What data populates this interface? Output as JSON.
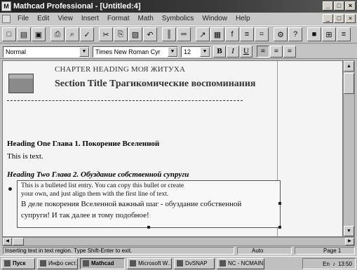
{
  "window": {
    "title": "Mathcad Professional - [Untitled:4]",
    "min_label": "_",
    "max_label": "□",
    "close_label": "×"
  },
  "menu": {
    "items": [
      "File",
      "Edit",
      "View",
      "Insert",
      "Format",
      "Math",
      "Symbolics",
      "Window",
      "Help"
    ]
  },
  "toolbar": {
    "buttons": [
      {
        "name": "new-icon",
        "glyph": "□"
      },
      {
        "name": "open-icon",
        "glyph": "▤"
      },
      {
        "name": "save-icon",
        "glyph": "▣"
      },
      {
        "name": "print-icon",
        "glyph": "⎙"
      },
      {
        "name": "print-preview-icon",
        "glyph": "⌕"
      },
      {
        "name": "spell-check-icon",
        "glyph": "✓"
      },
      {
        "name": "cut-icon",
        "glyph": "✂"
      },
      {
        "name": "copy-icon",
        "glyph": "⎘"
      },
      {
        "name": "paste-icon",
        "glyph": "▨"
      },
      {
        "name": "undo-icon",
        "glyph": "↶"
      },
      {
        "name": "align-vertical-icon",
        "glyph": "║"
      },
      {
        "name": "align-horizontal-icon",
        "glyph": "═"
      },
      {
        "name": "insert-graph-icon",
        "glyph": "↗"
      },
      {
        "name": "insert-matrix-icon",
        "glyph": "▦"
      },
      {
        "name": "insert-function-icon",
        "glyph": "f"
      },
      {
        "name": "insert-unit-icon",
        "glyph": "≡"
      },
      {
        "name": "calculate-icon",
        "glyph": "="
      },
      {
        "name": "component-icon",
        "glyph": "⚙"
      },
      {
        "name": "help-icon",
        "glyph": "?"
      },
      {
        "name": "resource-center-icon",
        "glyph": "■"
      },
      {
        "name": "tile-icon",
        "glyph": "⊞"
      },
      {
        "name": "arrange-icon",
        "glyph": "≡"
      }
    ]
  },
  "format": {
    "style": "Normal",
    "font": "Times New Roman Cyr",
    "size": "12",
    "bold": "B",
    "italic": "I",
    "underline": "U",
    "align_left": "≡",
    "align_center": "≡",
    "align_right": "≡"
  },
  "document": {
    "chapter": "CHAPTER HEADING МОЯ ЖИТУХА",
    "section": "Section Title Трагикомические воспоминания",
    "heading_one": "Heading One Глава 1. Покорение Вселенной",
    "text": "This is text.",
    "heading_two": "Heading Two Глава 2. Обуздание собственной супруги",
    "bullet_lines": [
      "This is a bulleted list entry.  You can copy this bullet or create",
      "your own, and just align them with the first line of text.",
      "В деле покорения Вселенной важный шаг - обуздание собственной",
      "супруги! И так далее и тому подобное!"
    ]
  },
  "status": {
    "message": "Inserting text in text region.  Type Shift-Enter to exit.",
    "mode": "Auto",
    "page": "Page 1"
  },
  "taskbar": {
    "start": "Пуск",
    "tasks": [
      "Инфо сист...",
      "Mathcad",
      "Microsoft W...",
      "DvSNAP",
      "NC - NCMAIN"
    ],
    "clock": "13:50",
    "lang": "En"
  }
}
